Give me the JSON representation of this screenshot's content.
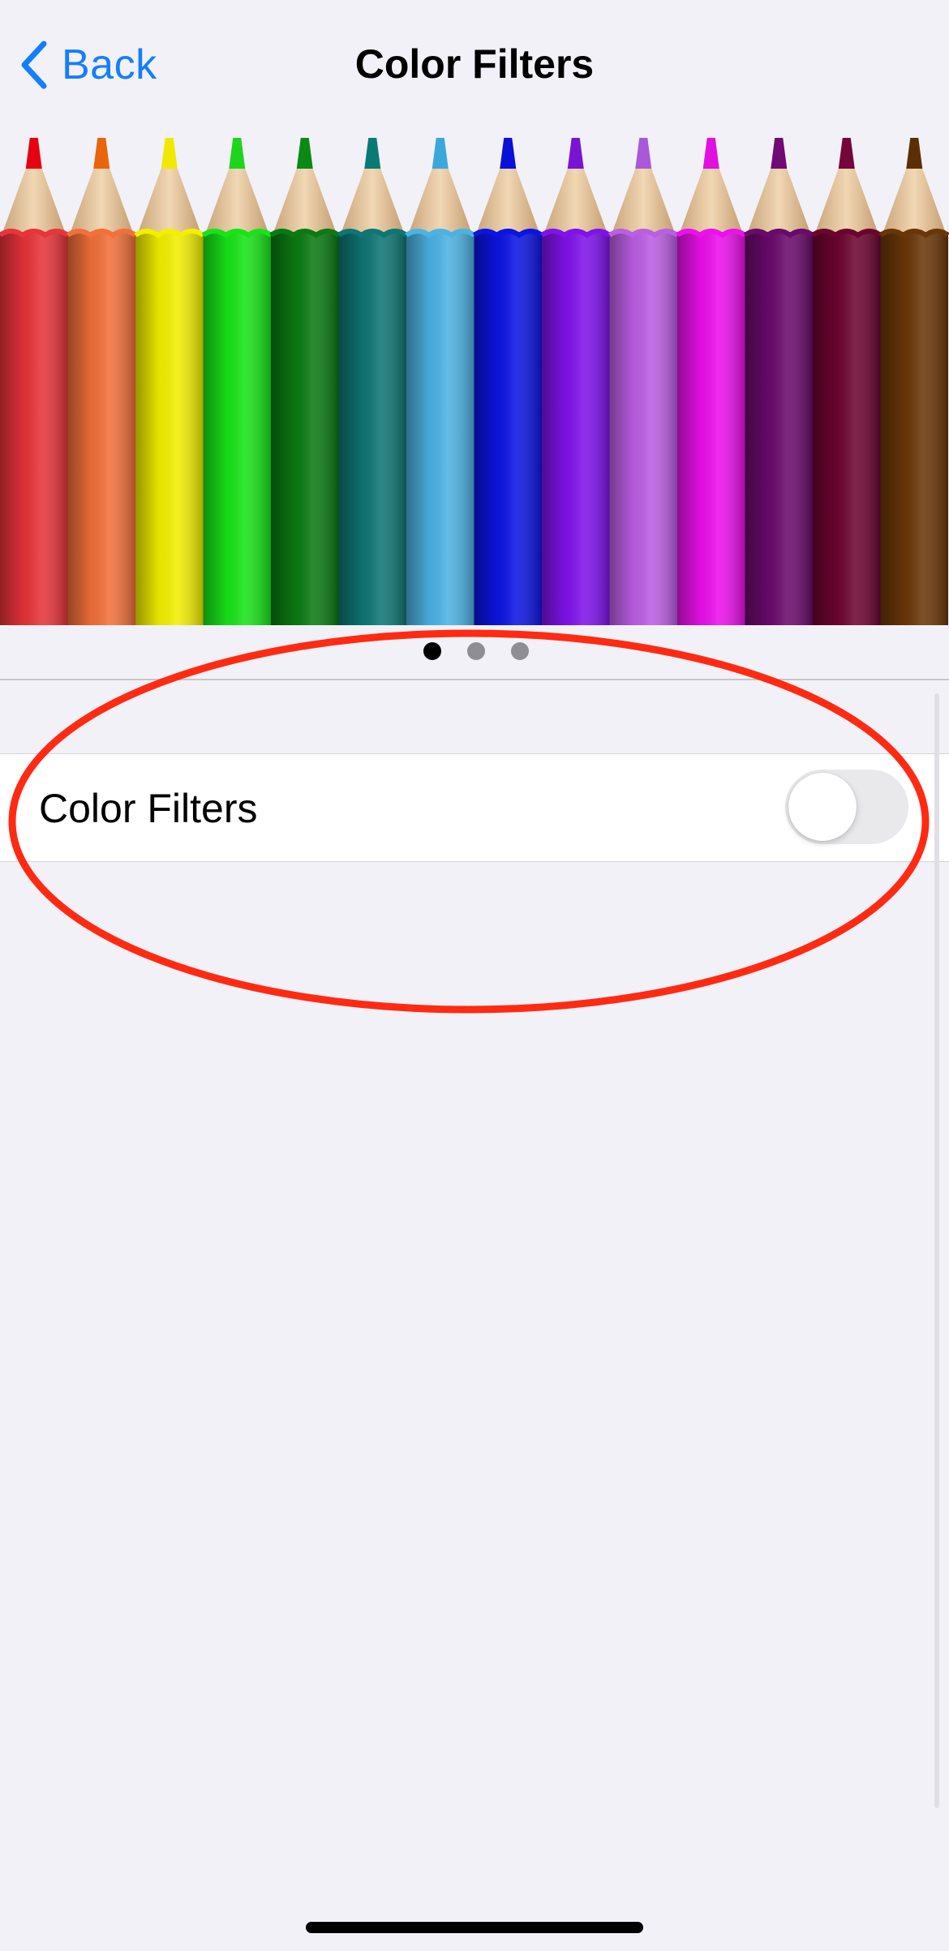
{
  "nav": {
    "back_label": "Back",
    "title": "Color Filters"
  },
  "banner": {
    "pencil_colors": [
      {
        "tip": "#e60012",
        "body": "#e8343a"
      },
      {
        "tip": "#e8650a",
        "body": "#f2703a"
      },
      {
        "tip": "#f0e800",
        "body": "#f3ef00"
      },
      {
        "tip": "#1ed41e",
        "body": "#18e418"
      },
      {
        "tip": "#0a8a14",
        "body": "#0a7a12"
      },
      {
        "tip": "#0a7a76",
        "body": "#0e7674"
      },
      {
        "tip": "#3aa8dc",
        "body": "#4cb2e4"
      },
      {
        "tip": "#0a10d8",
        "body": "#0c14e4"
      },
      {
        "tip": "#7a14d4",
        "body": "#8012ec"
      },
      {
        "tip": "#a858d8",
        "body": "#bc5ee4"
      },
      {
        "tip": "#e010e0",
        "body": "#ec10ec"
      },
      {
        "tip": "#700a74",
        "body": "#6a0a6c"
      },
      {
        "tip": "#74063a",
        "body": "#6c0430"
      },
      {
        "tip": "#5c2e06",
        "body": "#6a3608"
      }
    ],
    "page_count": 3,
    "current_page": 1
  },
  "settings": {
    "color_filters_label": "Color Filters",
    "color_filters_enabled": false
  },
  "colors": {
    "accent": "#147efb",
    "annotation": "#ff2a12",
    "background": "#f2f1f7"
  }
}
